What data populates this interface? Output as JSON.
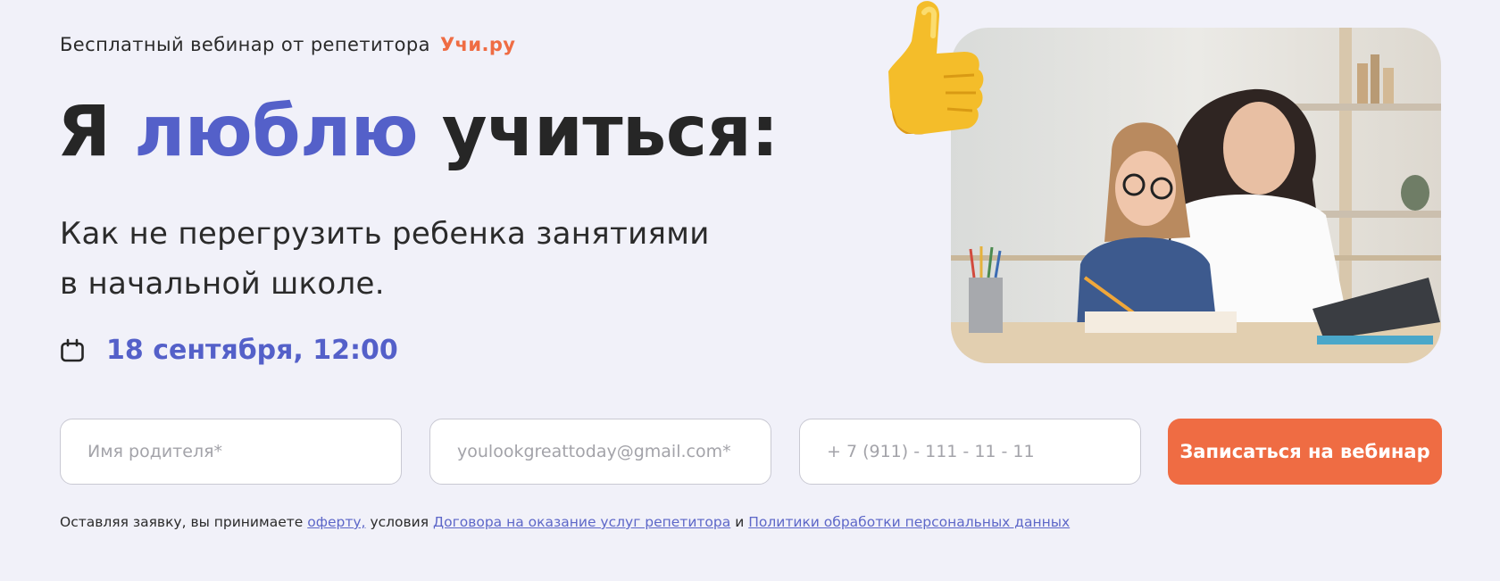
{
  "eyebrow": {
    "text": "Бесплатный вебинар от репетитора",
    "brand": "Учи.ру"
  },
  "headline": {
    "part1": "Я",
    "accent": "люблю",
    "part2": "учиться:"
  },
  "subtitle": {
    "line1": "Как не перегрузить ребенка занятиями",
    "line2": "в начальной школе."
  },
  "event": {
    "date_time": "18 сентября, 12:00",
    "icon": "calendar-icon"
  },
  "form": {
    "name_placeholder": "Имя родителя*",
    "email_placeholder": "youlookgreattoday@gmail.com*",
    "phone_placeholder": "+ 7 (911) - 111 - 11 - 11",
    "submit_label": "Записаться на вебинар"
  },
  "legal": {
    "prefix": "Оставляя заявку, вы принимаете",
    "offer_link": "оферту,",
    "middle": "условия",
    "contract_link": "Договора на оказание услуг репетитора",
    "and": "и",
    "privacy_link": "Политики обработки персональных данных"
  },
  "colors": {
    "background": "#f1f1f9",
    "accent_blue": "#5460c9",
    "brand_orange": "#ef6c43",
    "text": "#262626"
  },
  "decorations": {
    "thumb": "thumbs-up-icon",
    "photo": "mother-and-daughter-studying-photo"
  }
}
